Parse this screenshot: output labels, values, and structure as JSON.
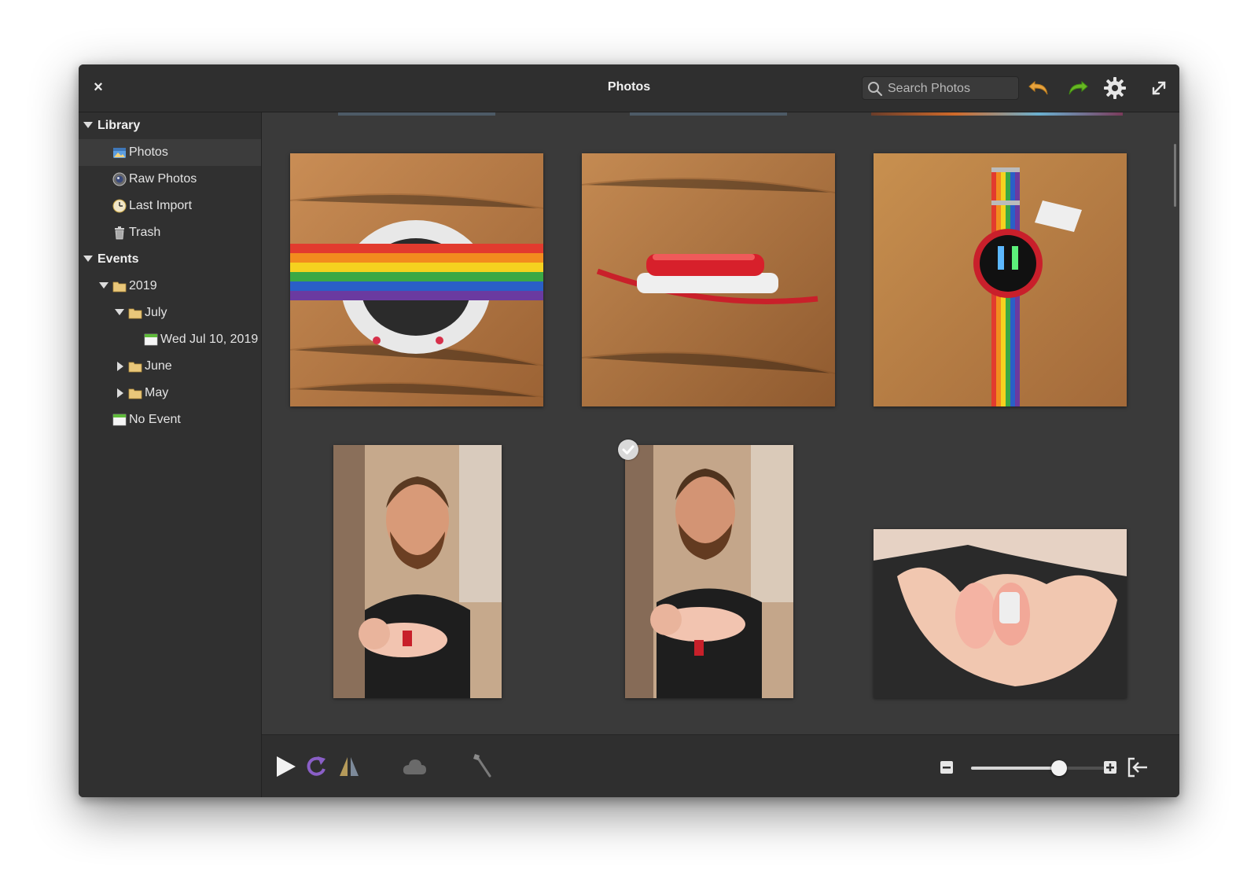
{
  "window": {
    "title": "Photos"
  },
  "toolbar": {
    "close_label": "×",
    "search_placeholder": "Search Photos",
    "icons": [
      "search-icon",
      "undo-icon",
      "redo-icon",
      "gear-icon",
      "fullscreen-icon"
    ]
  },
  "sidebar": {
    "library": {
      "label": "Library",
      "items": [
        {
          "label": "Photos",
          "icon": "photos-icon",
          "selected": true
        },
        {
          "label": "Raw Photos",
          "icon": "raw-photos-icon"
        },
        {
          "label": "Last Import",
          "icon": "last-import-icon"
        },
        {
          "label": "Trash",
          "icon": "trash-icon"
        }
      ]
    },
    "events": {
      "label": "Events",
      "year": "2019",
      "july": "July",
      "july_day": "Wed Jul 10, 2019",
      "june": "June",
      "may": "May",
      "no_event": "No Event"
    }
  },
  "photos": [
    {
      "subject": "rainbow-strap-watch-side",
      "selected": false
    },
    {
      "subject": "red-watch-profile",
      "selected": false
    },
    {
      "subject": "rainbow-strap-watch-face",
      "selected": false
    },
    {
      "subject": "man-holding-newborn-smiling",
      "selected": false
    },
    {
      "subject": "man-holding-newborn-looking-down",
      "selected": true
    },
    {
      "subject": "baby-feet-in-hands",
      "selected": false
    }
  ],
  "bottombar": {
    "icons": [
      "play-icon",
      "rotate-icon",
      "flip-icon",
      "cloud-icon",
      "enhance-icon",
      "zoom-out-icon",
      "zoom-in-icon",
      "sidebar-toggle-icon"
    ],
    "zoom_level": 0.6
  },
  "colors": {
    "accent_undo": "#e8a33d",
    "accent_redo": "#68b723",
    "rotate": "#8a5fc7"
  }
}
